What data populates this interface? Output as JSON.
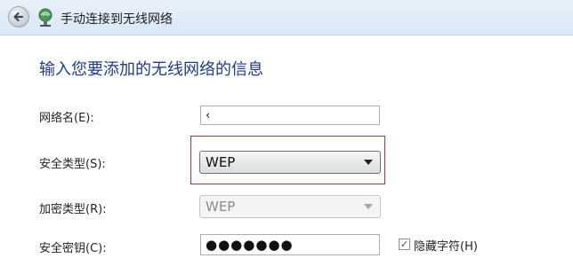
{
  "window": {
    "title": "手动连接到无线网络",
    "icon": "network-icon",
    "back_icon": "back-arrow-icon"
  },
  "page": {
    "heading": "输入您要添加的无线网络的信息"
  },
  "form": {
    "network_name": {
      "label": "网络名(E):",
      "value": "‹"
    },
    "security_type": {
      "label": "安全类型(S):",
      "value": "WEP"
    },
    "encryption_type": {
      "label": "加密类型(R):",
      "value": "WEP"
    },
    "security_key": {
      "label": "安全密钥(C):",
      "value": "●●●●●●●"
    },
    "hide_chars": {
      "label": "隐藏字符(H)",
      "checked": true,
      "check_glyph": "✓"
    }
  },
  "colors": {
    "heading": "#1e3c8c",
    "highlight_box": "#a33a3a"
  }
}
